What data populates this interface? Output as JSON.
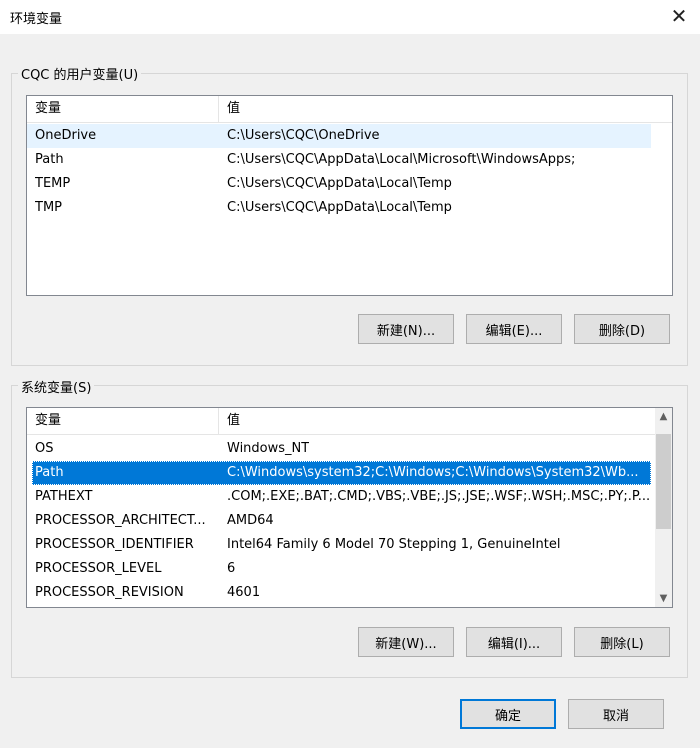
{
  "window": {
    "title": "环境变量",
    "close_glyph": "✕"
  },
  "user_vars": {
    "group_label": "CQC 的用户变量(U)",
    "columns": [
      "变量",
      "值"
    ],
    "rows": [
      {
        "name": "OneDrive",
        "value": "C:\\Users\\CQC\\OneDrive"
      },
      {
        "name": "Path",
        "value": "C:\\Users\\CQC\\AppData\\Local\\Microsoft\\WindowsApps;"
      },
      {
        "name": "TEMP",
        "value": "C:\\Users\\CQC\\AppData\\Local\\Temp"
      },
      {
        "name": "TMP",
        "value": "C:\\Users\\CQC\\AppData\\Local\\Temp"
      }
    ],
    "buttons": {
      "new": "新建(N)...",
      "edit": "编辑(E)...",
      "delete": "删除(D)"
    }
  },
  "system_vars": {
    "group_label": "系统变量(S)",
    "columns": [
      "变量",
      "值"
    ],
    "rows": [
      {
        "name": "OS",
        "value": "Windows_NT"
      },
      {
        "name": "Path",
        "value": "C:\\Windows\\system32;C:\\Windows;C:\\Windows\\System32\\Wb..."
      },
      {
        "name": "PATHEXT",
        "value": ".COM;.EXE;.BAT;.CMD;.VBS;.VBE;.JS;.JSE;.WSF;.WSH;.MSC;.PY;.P..."
      },
      {
        "name": "PROCESSOR_ARCHITECT...",
        "value": "AMD64"
      },
      {
        "name": "PROCESSOR_IDENTIFIER",
        "value": "Intel64 Family 6 Model 70 Stepping 1, GenuineIntel"
      },
      {
        "name": "PROCESSOR_LEVEL",
        "value": "6"
      },
      {
        "name": "PROCESSOR_REVISION",
        "value": "4601"
      }
    ],
    "buttons": {
      "new": "新建(W)...",
      "edit": "编辑(I)...",
      "delete": "删除(L)"
    },
    "scroll_up_glyph": "▲",
    "scroll_down_glyph": "▼"
  },
  "footer": {
    "ok": "确定",
    "cancel": "取消"
  },
  "colors": {
    "selection": "#0078d7",
    "hover": "#e5f3ff",
    "background": "#f0f0f0"
  }
}
